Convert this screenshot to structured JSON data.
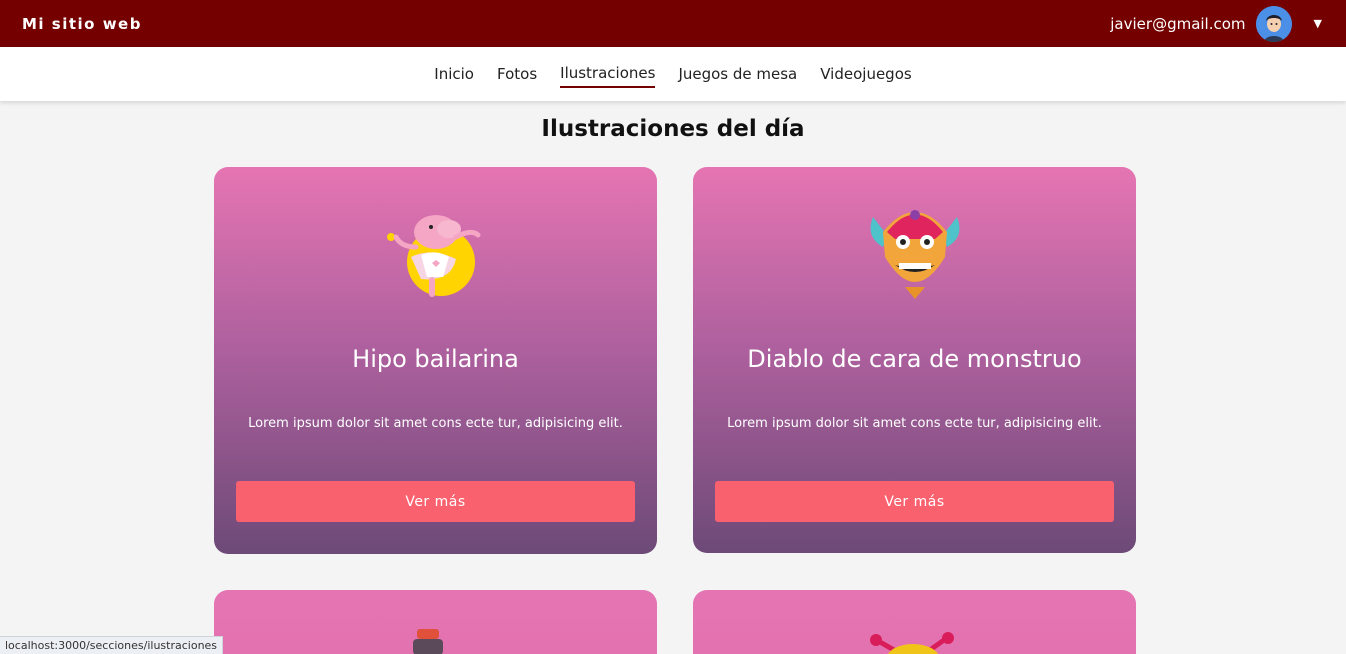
{
  "header": {
    "brand": "Mi sitio web",
    "user_email": "javier@gmail.com",
    "caret": "▼"
  },
  "nav": {
    "items": [
      "Inicio",
      "Fotos",
      "Ilustraciones",
      "Juegos de mesa",
      "Videojuegos"
    ],
    "active": "Ilustraciones"
  },
  "page": {
    "title": "Ilustraciones del día"
  },
  "cards": [
    {
      "title": "Hipo bailarina",
      "text": "Lorem ipsum dolor sit amet cons ecte tur, adipisicing elit.",
      "button": "Ver más",
      "icon": "hippo-ballerina-icon"
    },
    {
      "title": "Diablo de cara de monstruo",
      "text": "Lorem ipsum dolor sit amet cons ecte tur, adipisicing elit.",
      "button": "Ver más",
      "icon": "monster-devil-face-icon"
    }
  ],
  "status_bar": {
    "url": "localhost:3000/secciones/ilustraciones"
  },
  "colors": {
    "header_bg": "#740000",
    "card_top": "#e575b2",
    "card_bottom": "#6d4a78",
    "button_bg": "#f9616f"
  }
}
